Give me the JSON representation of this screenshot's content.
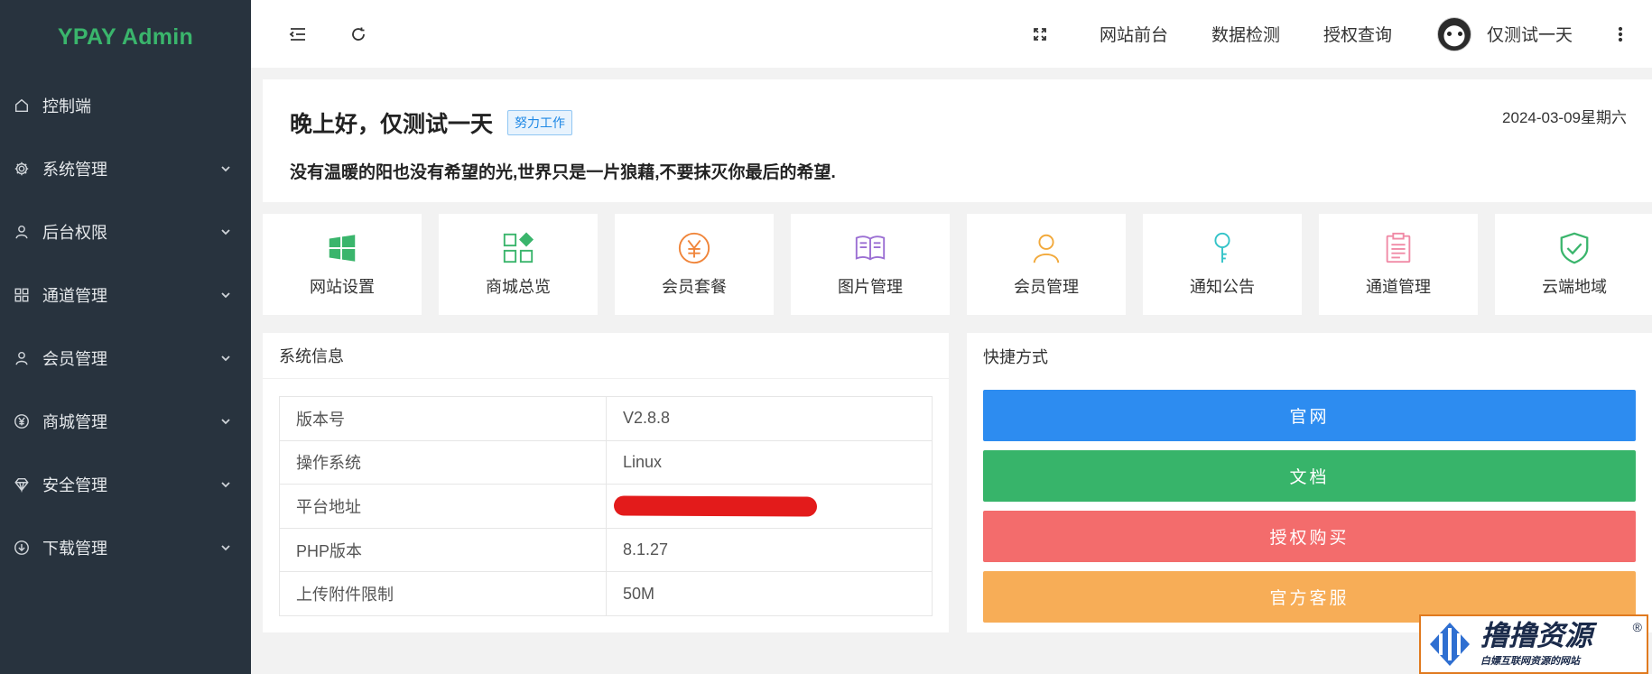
{
  "app": {
    "logo": "YPAY Admin",
    "accent": "#3ab56c",
    "sidebar_bg": "#28333e"
  },
  "sidebar": {
    "items": [
      {
        "label": "控制端",
        "icon": "home-icon",
        "expandable": false
      },
      {
        "label": "系统管理",
        "icon": "gear-icon",
        "expandable": true
      },
      {
        "label": "后台权限",
        "icon": "user-icon",
        "expandable": true
      },
      {
        "label": "通道管理",
        "icon": "apps-icon",
        "expandable": true
      },
      {
        "label": "会员管理",
        "icon": "user-icon",
        "expandable": true
      },
      {
        "label": "商城管理",
        "icon": "yen-circle-icon",
        "expandable": true
      },
      {
        "label": "安全管理",
        "icon": "diamond-icon",
        "expandable": true
      },
      {
        "label": "下载管理",
        "icon": "download-circle-icon",
        "expandable": true
      }
    ]
  },
  "header": {
    "links": [
      "网站前台",
      "数据检测",
      "授权查询"
    ],
    "user_name": "仅测试一天"
  },
  "greeting": {
    "title": "晚上好，仅测试一天",
    "badge": "努力工作",
    "date": "2024-03-09星期六",
    "quote": "没有温暖的阳也没有希望的光,世界只是一片狼藉,不要抹灭你最后的希望."
  },
  "tiles": [
    {
      "label": "网站设置",
      "icon": "windows-icon",
      "color": "#3ab56c"
    },
    {
      "label": "商城总览",
      "icon": "apps-add-icon",
      "color": "#3ab56c"
    },
    {
      "label": "会员套餐",
      "icon": "yen-circle-icon",
      "color": "#f0853a"
    },
    {
      "label": "图片管理",
      "icon": "book-open-icon",
      "color": "#9b6fd3"
    },
    {
      "label": "会员管理",
      "icon": "user-icon",
      "color": "#f2a93b"
    },
    {
      "label": "通知公告",
      "icon": "key-icon",
      "color": "#33c3c8"
    },
    {
      "label": "通道管理",
      "icon": "clipboard-icon",
      "color": "#f08aa6"
    },
    {
      "label": "云端地域",
      "icon": "shield-check-icon",
      "color": "#3ab56c"
    }
  ],
  "system_info": {
    "title": "系统信息",
    "rows": [
      {
        "key": "版本号",
        "value": "V2.8.8"
      },
      {
        "key": "操作系统",
        "value": "Linux"
      },
      {
        "key": "平台地址",
        "value": ""
      },
      {
        "key": "PHP版本",
        "value": "8.1.27"
      },
      {
        "key": "上传附件限制",
        "value": "50M"
      }
    ]
  },
  "shortcuts": {
    "title": "快捷方式",
    "buttons": [
      {
        "label": "官网",
        "color": "#2d8cf0"
      },
      {
        "label": "文档",
        "color": "#37b46a"
      },
      {
        "label": "授权购买",
        "color": "#f36c6c"
      },
      {
        "label": "官方客服",
        "color": "#f7ad57"
      }
    ]
  },
  "watermark": {
    "main": "撸撸资源",
    "sub": "白嫖互联网资源的网站",
    "reg": "®"
  }
}
